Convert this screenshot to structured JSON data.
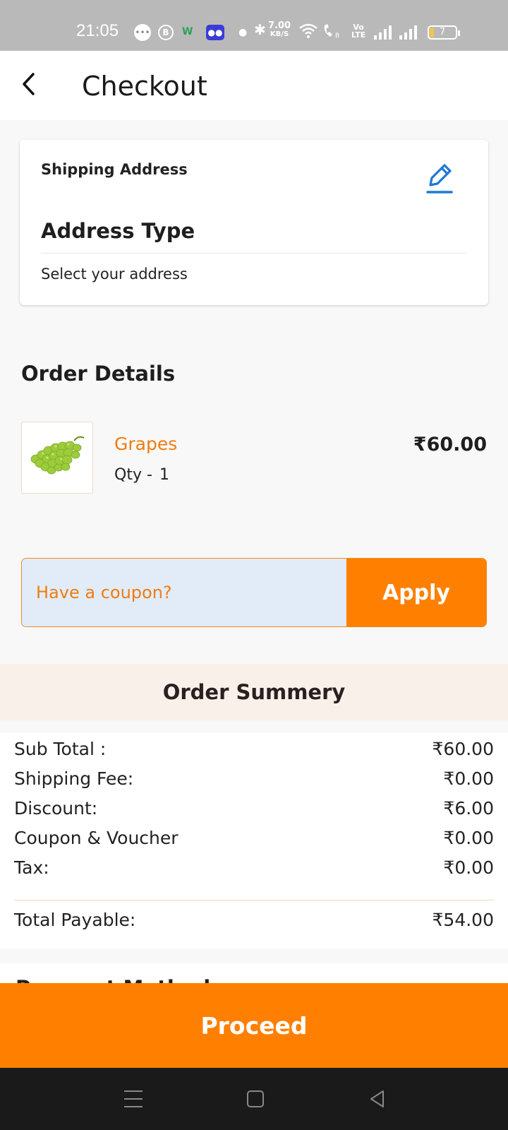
{
  "status_bar": {
    "time": "21:05",
    "network_speed_value": "7.00",
    "network_speed_unit": "KB/S",
    "volte_top": "Vo",
    "volte_bottom": "LTE",
    "battery_level": "7"
  },
  "header": {
    "title": "Checkout"
  },
  "shipping": {
    "heading": "Shipping Address",
    "address_type": "Address Type",
    "select_prompt": "Select your address"
  },
  "order_details": {
    "title": "Order Details",
    "items": [
      {
        "name": "Grapes",
        "qty_label": "Qty -",
        "qty": "1",
        "price": "₹60.00"
      }
    ]
  },
  "coupon": {
    "placeholder": "Have a coupon?",
    "apply_label": "Apply"
  },
  "summary": {
    "title": "Order Summery",
    "rows": [
      {
        "label": "Sub Total :",
        "value": "₹60.00"
      },
      {
        "label": "Shipping Fee:",
        "value": "₹0.00"
      },
      {
        "label": "Discount:",
        "value": "₹6.00"
      },
      {
        "label": "Coupon & Voucher",
        "value": "₹0.00"
      },
      {
        "label": "Tax:",
        "value": "₹0.00"
      }
    ],
    "total_label": "Total Payable:",
    "total_value": "₹54.00"
  },
  "payment": {
    "title": "Payment Method"
  },
  "proceed_label": "Proceed",
  "colors": {
    "accent": "#ff7f00",
    "item_name": "#f07c10",
    "edit_icon": "#1e78d6",
    "coupon_bg": "#e1ecf8",
    "summary_header_bg": "#faf0ea"
  },
  "icons": {
    "back": "chevron-left-icon",
    "edit": "pencil-icon",
    "item": "grapes-image"
  }
}
